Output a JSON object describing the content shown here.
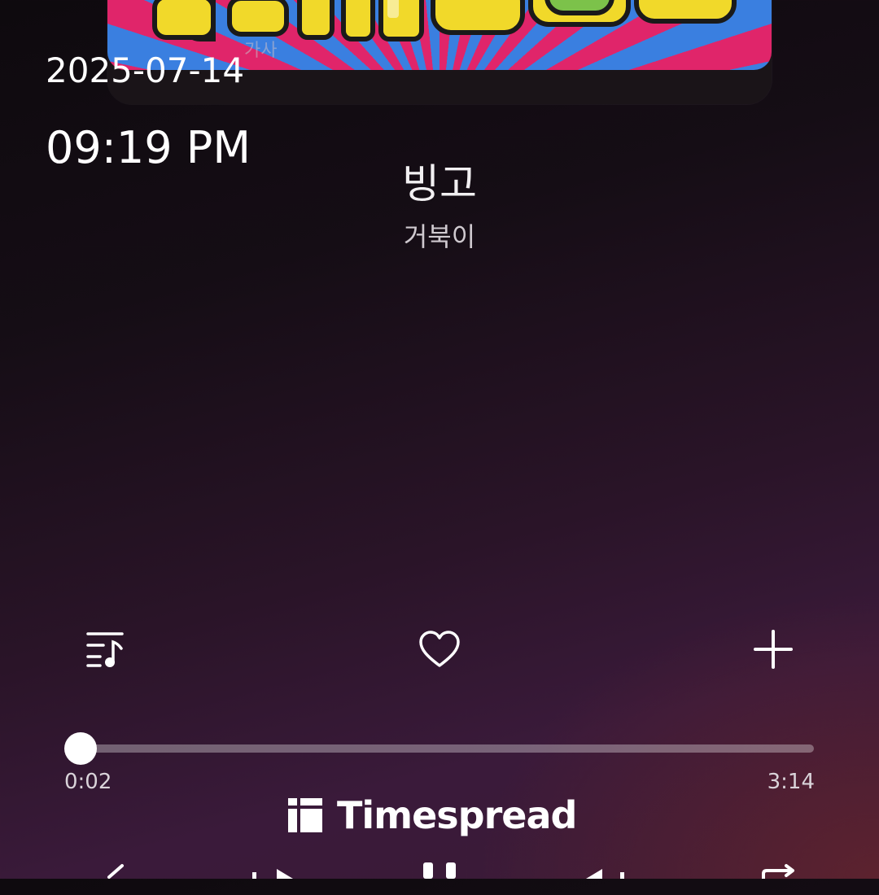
{
  "overlay": {
    "date": "2025-07-14",
    "time": "09:19 PM"
  },
  "album": {
    "lyrics_label": "가사"
  },
  "song": {
    "title": "빙고",
    "artist": "거북이"
  },
  "actions": {
    "playlist_icon": "playlist-icon",
    "like_icon": "heart-icon",
    "add_icon": "plus-icon"
  },
  "playback": {
    "elapsed": "0:02",
    "total": "3:14",
    "progress_fraction": 0.01
  },
  "watermark": {
    "text": "Timespread"
  },
  "controls": {
    "shuffle_icon": "shuffle-icon",
    "prev_icon": "previous-icon",
    "play_icon": "pause-icon",
    "next_icon": "next-icon",
    "repeat_icon": "repeat-icon"
  },
  "colors": {
    "background_top": "#0e0a0e",
    "background_bottom": "#3b1b36",
    "accent": "#ffffff"
  }
}
